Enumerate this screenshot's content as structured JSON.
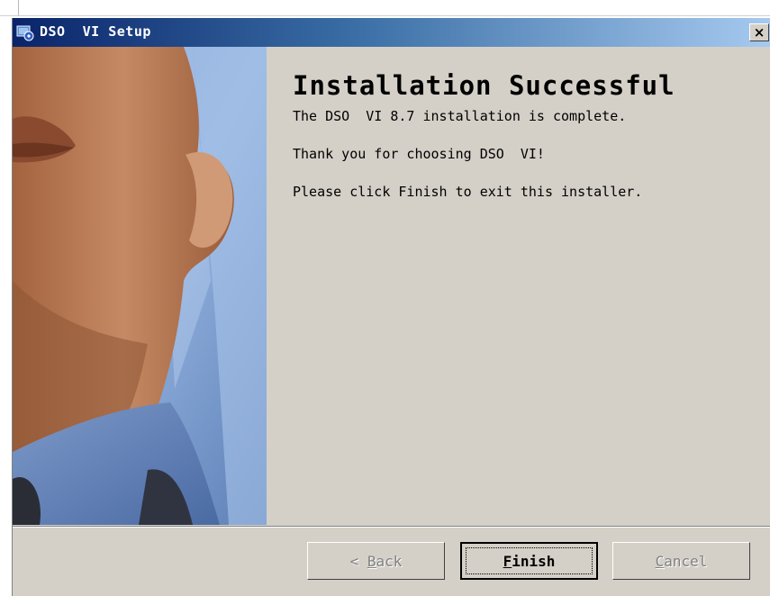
{
  "window": {
    "title": "DSO  VI Setup",
    "close_label": "×"
  },
  "content": {
    "heading": "Installation Successful",
    "lines": [
      "The DSO  VI 8.7 installation is complete.",
      "Thank you for choosing DSO  VI!",
      "Please click Finish to exit this installer."
    ]
  },
  "buttons": {
    "back": {
      "arrow": "< ",
      "mnemonic": "B",
      "rest": "ack",
      "enabled": false
    },
    "finish": {
      "mnemonic": "F",
      "rest": "inish",
      "enabled": true
    },
    "cancel": {
      "mnemonic": "C",
      "rest": "ancel",
      "enabled": false
    }
  },
  "icons": {
    "app": "setup-app-icon",
    "close": "close-icon"
  },
  "colors": {
    "titlebar_start": "#0a246a",
    "titlebar_end": "#a6caf0",
    "dialog_bg": "#d4d0c8"
  }
}
